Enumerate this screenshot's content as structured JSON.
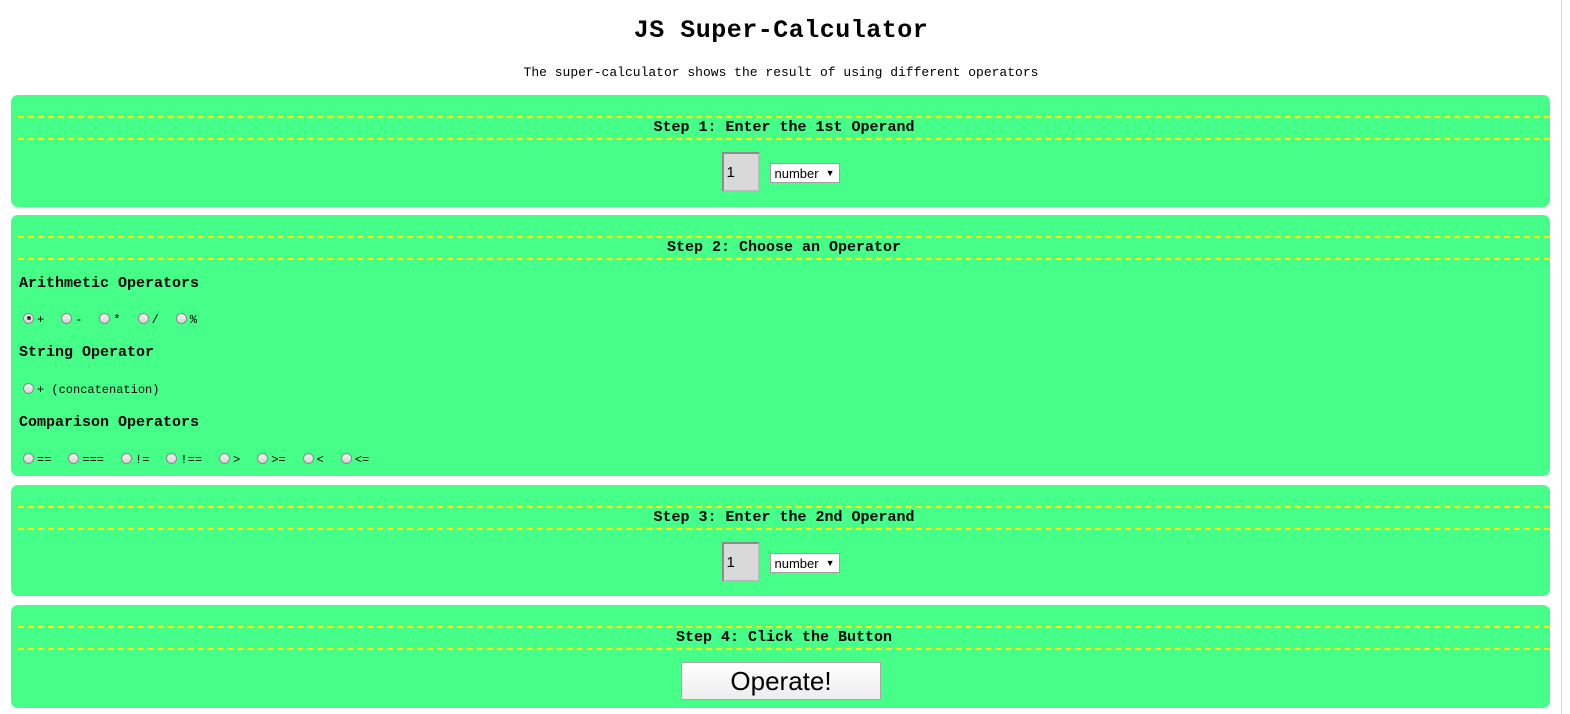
{
  "header": {
    "title": "JS Super-Calculator",
    "subtitle": "The super-calculator shows the result of using different operators"
  },
  "step1": {
    "heading": "Step 1: Enter the 1st Operand",
    "operand_value": "1",
    "type_selected": "number"
  },
  "step2": {
    "heading": "Step 2: Choose an Operator",
    "arithmetic_title": "Arithmetic Operators",
    "arithmetic": [
      "+",
      "-",
      "*",
      "/",
      "%"
    ],
    "arithmetic_selected": "+",
    "string_title": "String Operator",
    "string": [
      "+ (concatenation)"
    ],
    "comparison_title": "Comparison Operators",
    "comparison": [
      "==",
      "===",
      "!=",
      "!==",
      ">",
      ">=",
      "<",
      "<="
    ]
  },
  "step3": {
    "heading": "Step 3: Enter the 2nd Operand",
    "operand_value": "1",
    "type_selected": "number"
  },
  "step4": {
    "heading": "Step 4: Click the Button",
    "button_label": "Operate!"
  },
  "colors": {
    "panel": "#45ff88",
    "dashed_rule": "#ffea00"
  },
  "icons": {
    "select_caret": "caret-down-icon"
  }
}
